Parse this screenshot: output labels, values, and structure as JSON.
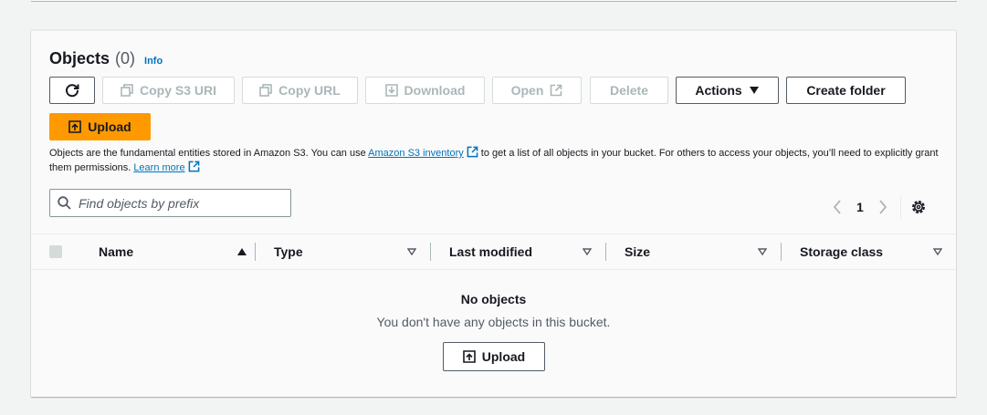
{
  "objects": {
    "title": "Objects",
    "count": "(0)",
    "info_label": "Info"
  },
  "toolbar": {
    "copy_s3_uri": "Copy S3 URI",
    "copy_url": "Copy URL",
    "download": "Download",
    "open": "Open",
    "delete": "Delete",
    "actions": "Actions",
    "create_folder": "Create folder",
    "upload": "Upload"
  },
  "description": {
    "part1": "Objects are the fundamental entities stored in Amazon S3. You can use ",
    "link1": "Amazon S3 inventory",
    "part2": " to get a list of all objects in your bucket. For others to access your objects, you’ll need to explicitly grant them permissions. ",
    "link2": "Learn more"
  },
  "search": {
    "placeholder": "Find objects by prefix"
  },
  "pagination": {
    "page": "1"
  },
  "table": {
    "columns": [
      "Name",
      "Type",
      "Last modified",
      "Size",
      "Storage class"
    ]
  },
  "empty_state": {
    "title": "No objects",
    "message": "You don't have any objects in this bucket.",
    "upload_label": "Upload"
  },
  "colors": {
    "primary": "#ff9900",
    "link": "#0073bb",
    "text": "#16191f",
    "disabled": "#aab7b8"
  }
}
